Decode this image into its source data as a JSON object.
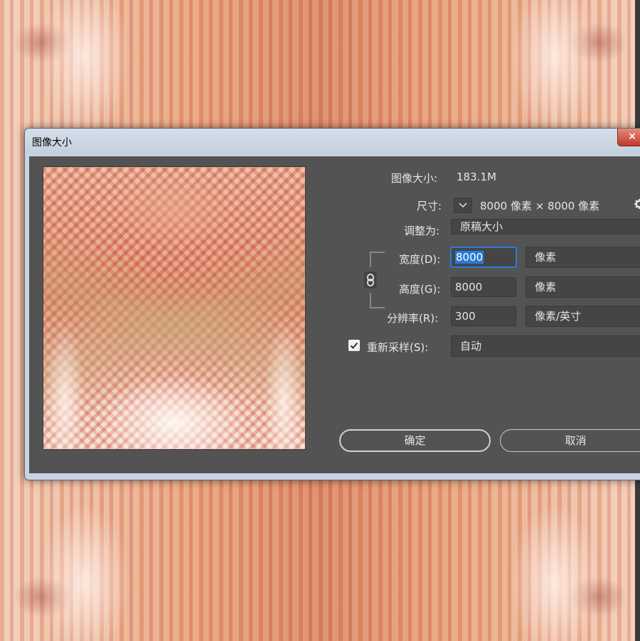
{
  "dialog": {
    "title": "图像大小",
    "close_label": "×",
    "image_size_label": "图像大小:",
    "image_size_value": "183.1M",
    "dimensions_label": "尺寸:",
    "dimensions_value": "8000 像素  ×  8000 像素",
    "fit_to_label": "调整为:",
    "fit_to_value": "原稿大小",
    "width_label": "宽度(D):",
    "width_value": "8000",
    "width_unit": "像素",
    "height_label": "高度(G):",
    "height_value": "8000",
    "height_unit": "像素",
    "resolution_label": "分辨率(R):",
    "resolution_value": "300",
    "resolution_unit": "像素/英寸",
    "resample_label": "重新采样(S):",
    "resample_checked": true,
    "resample_value": "自动",
    "ok_label": "确定",
    "cancel_label": "取消"
  },
  "icons": [
    "close-icon",
    "gear-icon",
    "chevron-down-icon",
    "chain-link-icon",
    "checkmark-icon"
  ],
  "colors": {
    "panel": "#535353",
    "field": "#454545",
    "focus": "#2a7bd8",
    "close": "#c0392b"
  }
}
